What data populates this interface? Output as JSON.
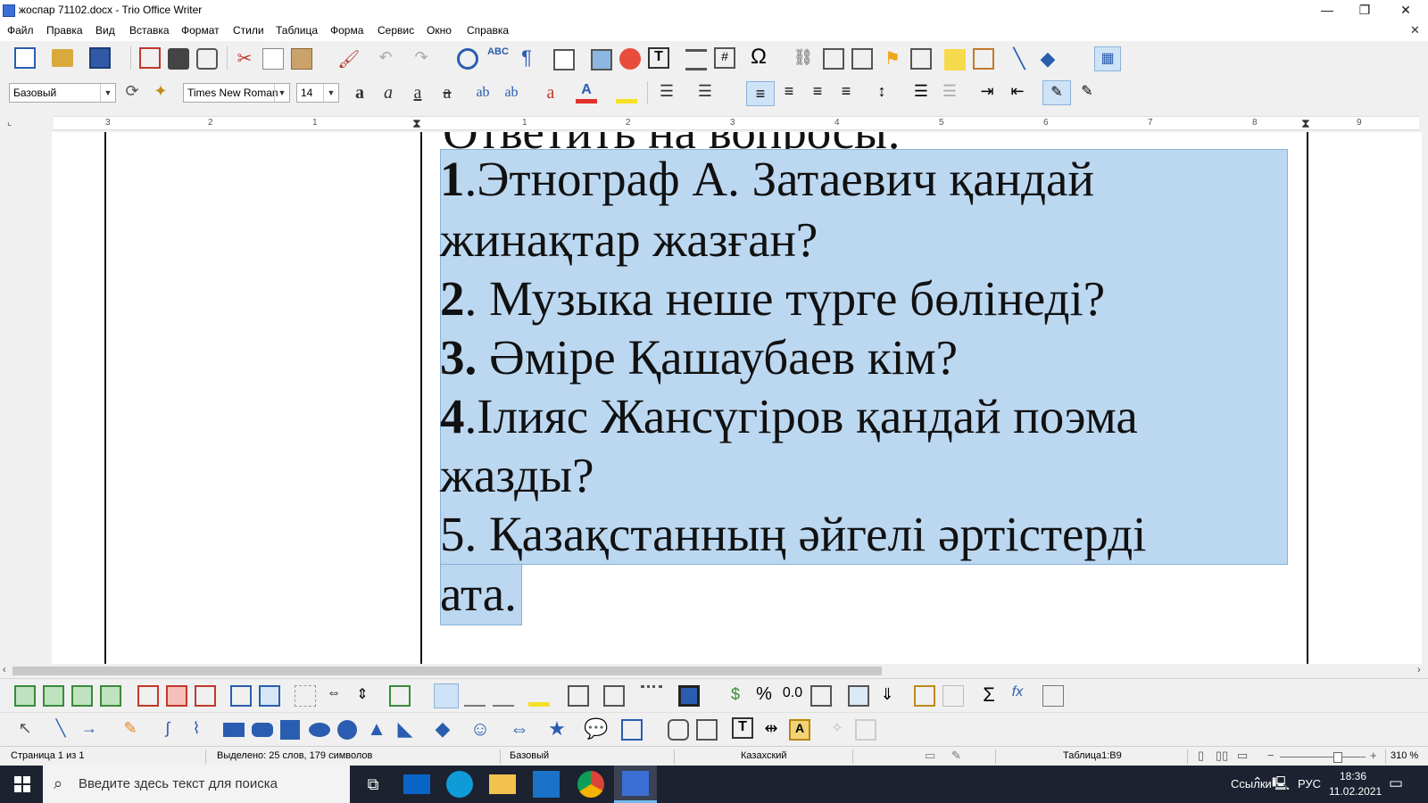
{
  "window": {
    "title": "жоспар 71102.docx - Trio Office Writer",
    "controls": {
      "minimize": "—",
      "restore": "❐",
      "close": "✕",
      "doc_close": "✕"
    }
  },
  "menu": [
    "Файл",
    "Правка",
    "Вид",
    "Вставка",
    "Формат",
    "Стили",
    "Таблица",
    "Форма",
    "Сервис",
    "Окно",
    "Справка"
  ],
  "format_bar": {
    "paragraph_style": "Базовый",
    "font_name": "Times New Roman",
    "font_size": "14"
  },
  "ruler": {
    "numbers": [
      "3",
      "2",
      "1",
      "1",
      "2",
      "3",
      "4",
      "5",
      "6",
      "7",
      "8",
      "9"
    ]
  },
  "document": {
    "partial_top_line": "Ответить на вопросы:",
    "lines": [
      {
        "num": "1",
        "text": ".Этнограф  А. Затаевич қандай"
      },
      {
        "num": "",
        "text": "жинақтар жазған?"
      },
      {
        "num": "2",
        "text": ". Музыка неше түрге бөлінеді?"
      },
      {
        "num": "3.",
        "text": " Әміре Қашаубаев кім?"
      },
      {
        "num": "4",
        "text": ".Ілияс Жансүгіров  қандай поэма"
      },
      {
        "num": "",
        "text": "жазды?"
      },
      {
        "num": "",
        "text": "5. Қазақстанның  әйгелі әртістерді"
      },
      {
        "num": "",
        "text": "ата."
      }
    ]
  },
  "statusbar": {
    "page": "Страница 1 из 1",
    "selection": "Выделено: 25 слов, 179 символов",
    "style": "Базовый",
    "language": "Казахский",
    "cell": "Таблица1:B9",
    "zoom": "310 %",
    "zoom_minus": "−",
    "zoom_plus": "+"
  },
  "taskbar": {
    "search_placeholder": "Введите здесь текст для поиска",
    "links_label": "Ссылки",
    "lang": "РУС",
    "time": "18:36",
    "date": "11.02.2021"
  },
  "colors": {
    "selection": "#bcd8f1",
    "taskbar": "#1c2230",
    "accent": "#3b6fd6"
  }
}
